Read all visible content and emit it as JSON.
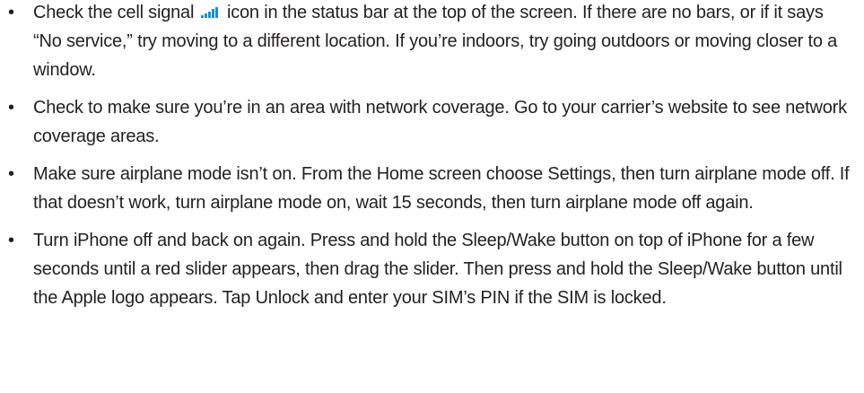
{
  "bullet_char": "•",
  "icon_color": "#1a8ed8",
  "items": [
    {
      "before_icon": "Check the cell signal ",
      "icon": "cell-signal-icon",
      "after_icon": " icon in the status bar at the top of the screen. If there are no bars, or if it says “No service,” try moving to a different location. If you’re indoors, try going outdoors or moving closer to a window."
    },
    {
      "text": "Check to make sure you’re in an area with network coverage. Go to your carrier’s website to see network coverage areas."
    },
    {
      "text": "Make sure airplane mode isn’t on. From the Home screen choose Settings, then turn airplane mode off. If that doesn’t work, turn airplane mode on, wait 15 seconds, then turn airplane mode off again."
    },
    {
      "text": "Turn iPhone off and back on again. Press and hold the Sleep/Wake button on top of iPhone for a few seconds until a red slider appears, then drag the slider. Then press and hold the Sleep/Wake button until the Apple logo appears. Tap Unlock and enter your SIM’s PIN if the SIM is locked."
    }
  ]
}
